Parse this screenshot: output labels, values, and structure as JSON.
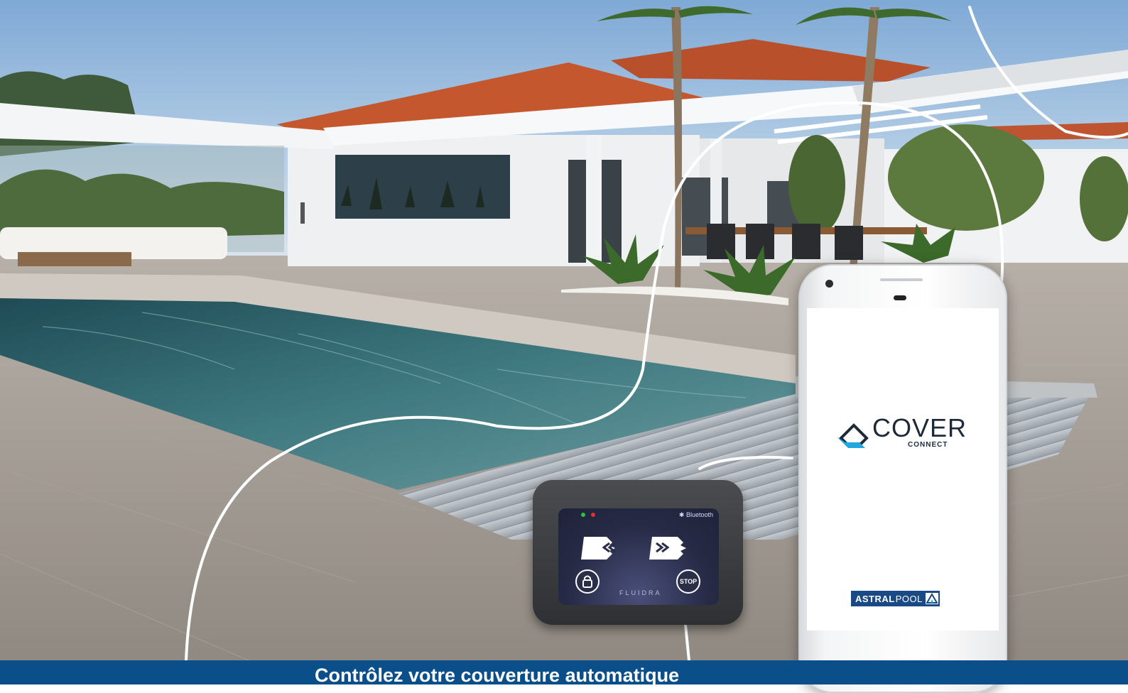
{
  "banner": {
    "text": "Contrôlez votre couverture automatique"
  },
  "phone_app": {
    "logo_main": "COVER",
    "logo_sub": "CONNECT",
    "brand_bold": "ASTRAL",
    "brand_light": "POOL"
  },
  "remote": {
    "bluetooth_label": "Bluetooth",
    "maker_label": "FLUIDRA",
    "stop_label": "STOP"
  },
  "icons": {
    "open_cover": "cover-open-icon",
    "close_cover": "cover-close-icon",
    "lock": "lock-icon",
    "bluetooth": "bluetooth-icon"
  },
  "colors": {
    "banner": "#0b4f8a",
    "app_logo_accent": "#23a7e0",
    "brand_blue": "#1a4a86"
  }
}
